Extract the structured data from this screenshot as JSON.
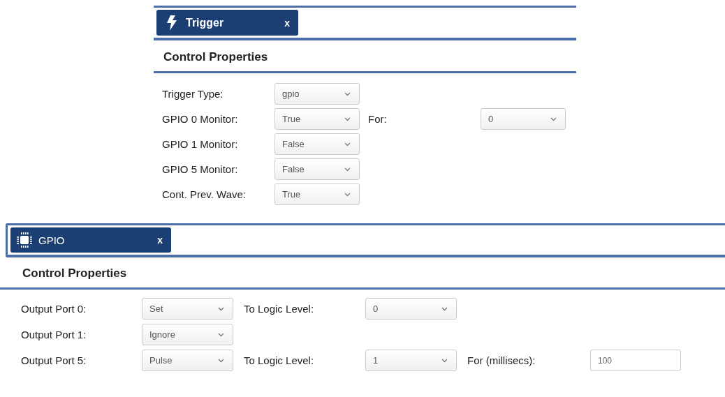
{
  "panels": [
    {
      "kind": "trigger",
      "tab": {
        "label": "Trigger",
        "close": "x"
      },
      "header": "Control Properties",
      "rows": [
        [
          {
            "kind": "label",
            "text": "Trigger Type:"
          },
          {
            "kind": "select",
            "value": "gpio"
          }
        ],
        [
          {
            "kind": "label",
            "text": "GPIO 0 Monitor:"
          },
          {
            "kind": "select",
            "value": "True"
          },
          {
            "kind": "label",
            "text": "For:"
          },
          {
            "kind": "select",
            "value": "0"
          }
        ],
        [
          {
            "kind": "label",
            "text": "GPIO 1 Monitor:"
          },
          {
            "kind": "select",
            "value": "False"
          }
        ],
        [
          {
            "kind": "label",
            "text": "GPIO 5 Monitor:"
          },
          {
            "kind": "select",
            "value": "False"
          }
        ],
        [
          {
            "kind": "label",
            "text": "Cont. Prev. Wave:"
          },
          {
            "kind": "select",
            "value": "True"
          }
        ]
      ]
    },
    {
      "kind": "gpio",
      "tab": {
        "label": "GPIO",
        "close": "x"
      },
      "header": "Control Properties",
      "rows": [
        [
          {
            "kind": "label",
            "text": "Output Port 0:"
          },
          {
            "kind": "select",
            "value": "Set"
          },
          {
            "kind": "label",
            "text": "To Logic Level:"
          },
          {
            "kind": "select",
            "value": "0"
          }
        ],
        [
          {
            "kind": "label",
            "text": "Output Port 1:"
          },
          {
            "kind": "select",
            "value": "Ignore"
          }
        ],
        [
          {
            "kind": "label",
            "text": "Output Port 5:"
          },
          {
            "kind": "select",
            "value": "Pulse"
          },
          {
            "kind": "label",
            "text": "To Logic Level:"
          },
          {
            "kind": "select",
            "value": "1"
          },
          {
            "kind": "label",
            "text": "For (millisecs):"
          },
          {
            "kind": "input",
            "value": "100"
          }
        ]
      ]
    }
  ]
}
